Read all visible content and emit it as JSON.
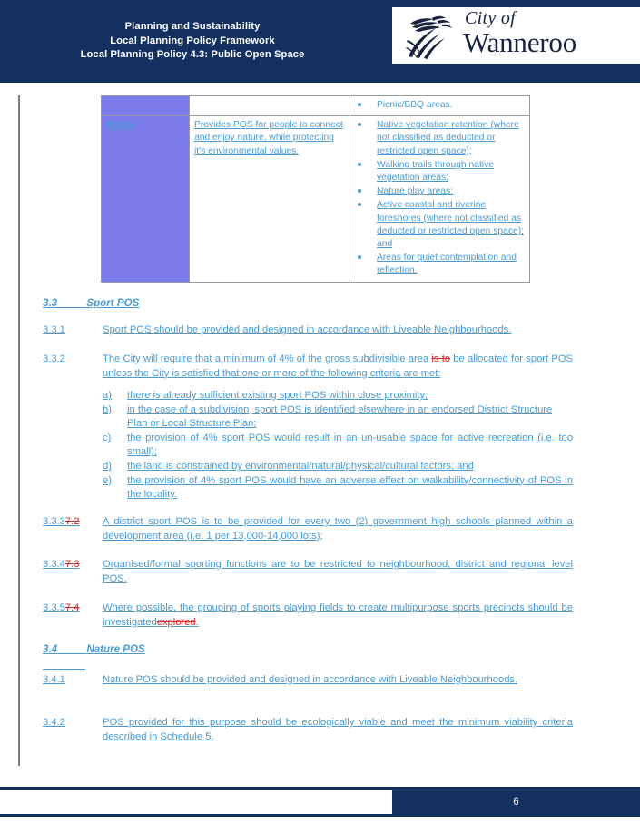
{
  "header": {
    "title_lines": [
      "Planning and Sustainability",
      "Local Planning Policy Framework",
      "Local Planning Policy 4.3: Public Open Space"
    ],
    "logo": {
      "line1": "City of",
      "line2": "Wanneroo",
      "mark_name": "banksia-plant-logo-icon"
    },
    "background_color": "#123160"
  },
  "table": {
    "rows": [
      {
        "name": "",
        "description": "",
        "examples": [
          {
            "text": "Picnic/BBQ areas.",
            "inserted": false
          }
        ],
        "name_cell_purple": true
      },
      {
        "name": "Nature",
        "description": "Provides POS for people to connect and enjoy nature, while protecting it's environmental values.",
        "examples": [
          {
            "text": "Native vegetation retention (where not classified as deducted or restricted open space);",
            "inserted": true
          },
          {
            "text": "Walking trails through native vegetation areas;",
            "inserted": true
          },
          {
            "text": "Nature play areas;",
            "inserted": true
          },
          {
            "text": "Active coastal and riverine foreshores (where not classified as deducted or restricted open space); and",
            "inserted": true
          },
          {
            "text": "Areas for quiet contemplation and reflection.",
            "inserted": true
          }
        ],
        "name_cell_purple": true
      }
    ],
    "fill_color": "#7b7bec",
    "border_color": "#9a9a9a"
  },
  "sections": {
    "sport": {
      "number": "3.3",
      "title": "Sport POS",
      "paragraphs": [
        {
          "number": "3.3.1",
          "text": "Sport POS should be provided and designed in accordance with Liveable Neighbourhoods."
        },
        {
          "number": "3.3.2",
          "text_before": "The City will  require that a minimum of 4% of the gross subdivisible area ",
          "deleted": "is to",
          "text_after": " be allocated for sport POS unless the City is satisfied that one or more of the following criteria are met:"
        },
        {
          "number_inserted": "3.3.3",
          "number_deleted": "7.2",
          "text": "A district sport POS is to be provided for every two (2) government high schools planned within a development area (i.e. 1 per 13,000-14,000 lots);"
        },
        {
          "number_inserted": "3.3.4",
          "number_deleted": "7.3",
          "text": "Organised/formal sporting functions are to be restricted to neighbourhood, district and regional level POS."
        },
        {
          "number_inserted": "3.3.5",
          "number_deleted": "7.4",
          "text_before": "Where possible, the grouping of sports playing fields to create multipurpose sports precincts should be investigated",
          "deleted": "explored",
          "text_after": "."
        }
      ],
      "criteria": [
        {
          "label": "a)",
          "text": "there is already sufficient existing sport POS within close proximity;"
        },
        {
          "label": "b)",
          "text": "in the case of a subdivision, sport POS is identified elsewhere in an endorsed District Structure Plan or Local Structure Plan;"
        },
        {
          "label": "c)",
          "text": "the provision of 4% sport POS would result in an un-usable space for active recreation (i.e. too small);"
        },
        {
          "label": "d)",
          "text": "the land is constrained by environmental/natural/physical/cultural factors; and"
        },
        {
          "label": "e)",
          "text": "the provision of 4% sport POS would have an adverse effect on walkability/connectivity of POS in the locality."
        }
      ]
    },
    "nature": {
      "number": "3.4",
      "title": "Nature POS",
      "paragraphs": [
        {
          "number": "3.4.1",
          "text": "Nature POS should be provided and designed in accordance with Liveable Neighbourhoods."
        },
        {
          "number": "3.4.2",
          "text": "POS provided for this purpose should be ecologically viable and meet the minimum viability criteria described in Schedule 5."
        }
      ]
    }
  },
  "footer": {
    "page_number": "6",
    "background_color": "#123160"
  },
  "colors": {
    "insert_text": "#4a9bd4",
    "delete_text": "#d42a2a",
    "navy": "#123160",
    "change_bar": "#7c7c7c"
  }
}
